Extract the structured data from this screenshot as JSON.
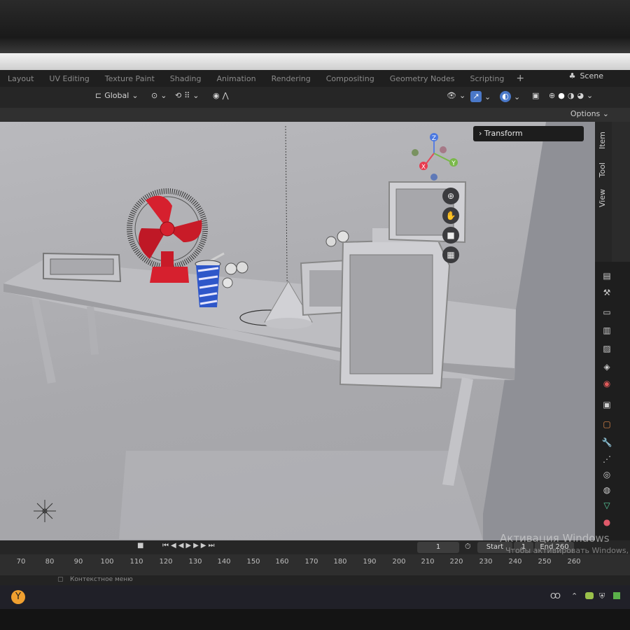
{
  "workspace_tabs": [
    "Layout",
    "UV Editing",
    "Texture Paint",
    "Shading",
    "Animation",
    "Rendering",
    "Compositing",
    "Geometry Nodes",
    "Scripting"
  ],
  "scene_label": "Scene",
  "header": {
    "transform_orientation": "Global"
  },
  "options_label": "Options",
  "sidebar": {
    "panel_title": "Transform",
    "tabs": [
      "Item",
      "Tool",
      "View"
    ]
  },
  "gizmo": {
    "z": "Z",
    "x": "X",
    "y": "Y"
  },
  "timeline": {
    "current_frame": "1",
    "start_label": "Start",
    "start_value": "1",
    "end_label": "End",
    "end_value": "260",
    "ruler": [
      "70",
      "80",
      "90",
      "100",
      "110",
      "120",
      "130",
      "140",
      "150",
      "160",
      "170",
      "180",
      "190",
      "200",
      "210",
      "220",
      "230",
      "240",
      "250",
      "260"
    ]
  },
  "status_text": "Контекстное меню",
  "watermark": {
    "title": "Активация Windows",
    "subtitle": "Чтобы активировать Windows, перейдите в раздел «Параметры»."
  },
  "colors": {
    "accent": "#4a78c8",
    "fan": "#d6202e",
    "viewport": "#b1b1b5"
  },
  "icons": [
    "zoom-icon",
    "hand-pan-icon",
    "camera-icon",
    "grid-icon",
    "light-icon",
    "wrench-icon",
    "shield-icon",
    "blender-logo-icon"
  ]
}
